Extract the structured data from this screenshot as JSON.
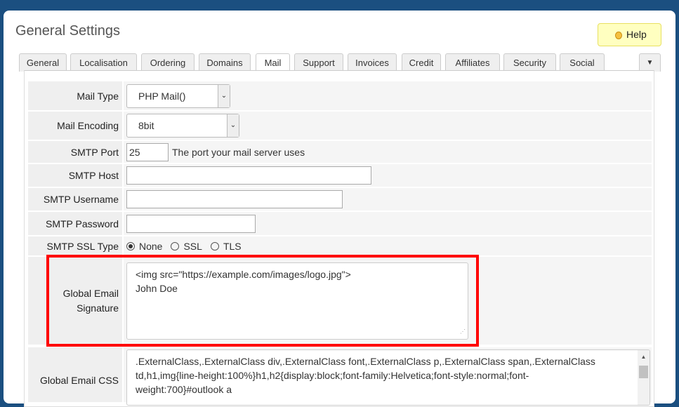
{
  "page_title": "General Settings",
  "help_label": "Help",
  "tabs": [
    "General",
    "Localisation",
    "Ordering",
    "Domains",
    "Mail",
    "Support",
    "Invoices",
    "Credit",
    "Affiliates",
    "Security",
    "Social"
  ],
  "active_tab": "Mail",
  "form": {
    "mail_type": {
      "label": "Mail Type",
      "value": "PHP Mail()"
    },
    "mail_encoding": {
      "label": "Mail Encoding",
      "value": "8bit"
    },
    "smtp_port": {
      "label": "SMTP Port",
      "value": "25",
      "hint": "The port your mail server uses"
    },
    "smtp_host": {
      "label": "SMTP Host",
      "value": ""
    },
    "smtp_username": {
      "label": "SMTP Username",
      "value": ""
    },
    "smtp_password": {
      "label": "SMTP Password",
      "value": ""
    },
    "smtp_ssl": {
      "label": "SMTP SSL Type",
      "options": [
        "None",
        "SSL",
        "TLS"
      ],
      "selected": "None"
    },
    "signature": {
      "label1": "Global Email",
      "label2": "Signature",
      "line1": "<img src=\"https://example.com/images/logo.jpg\">",
      "line2": "John Doe"
    },
    "css": {
      "label": "Global Email CSS",
      "line1": ".ExternalClass,.ExternalClass div,.ExternalClass font,.ExternalClass p,.ExternalClass span,.ExternalClass",
      "line2": "td,h1,img{line-height:100%}h1,h2{display:block;font-family:Helvetica;font-style:normal;font-",
      "line3": "weight:700}#outlook a"
    }
  },
  "colors": {
    "frame": "#1b4f80",
    "highlight": "#ff0000",
    "help_bg": "#ffffc0"
  }
}
